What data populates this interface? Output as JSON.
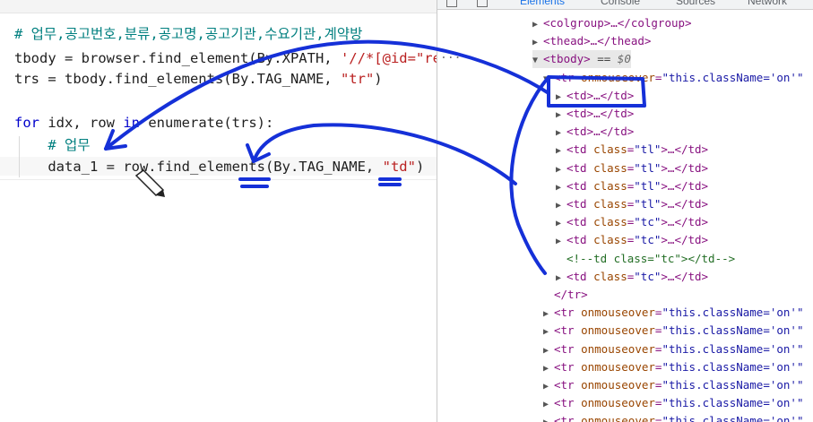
{
  "editor": {
    "lines": [
      {
        "tokens": [
          {
            "t": "# 업무,공고번호,분류,공고명,공고기관,수요기관,계약방",
            "c": "cm"
          }
        ]
      },
      {
        "tokens": [
          {
            "t": "tbody = browser.find_element(By.XPATH, ",
            "c": ""
          },
          {
            "t": "'//*[@id=\"resu",
            "c": "str"
          }
        ]
      },
      {
        "tokens": [
          {
            "t": "trs = tbody.find_elements(By.TAG_NAME, ",
            "c": ""
          },
          {
            "t": "\"tr\"",
            "c": "str"
          },
          {
            "t": ")",
            "c": ""
          }
        ]
      },
      {
        "tokens": []
      },
      {
        "tokens": [
          {
            "t": "for",
            "c": "kw"
          },
          {
            "t": " idx, row ",
            "c": ""
          },
          {
            "t": "in",
            "c": "kw"
          },
          {
            "t": " enumerate(trs):",
            "c": ""
          }
        ]
      },
      {
        "tokens": [
          {
            "t": "    # 업무",
            "c": "cm"
          }
        ]
      },
      {
        "tokens": [
          {
            "t": "    data_1 = row.find_elements(By.TAG_NAME, ",
            "c": ""
          },
          {
            "t": "\"td\"",
            "c": "str"
          },
          {
            "t": ")",
            "c": ""
          }
        ]
      }
    ]
  },
  "devtools": {
    "tabs": [
      "Elements",
      "Console",
      "Sources",
      "Network"
    ],
    "ellipsis": "...",
    "rows": [
      {
        "parts": [
          {
            "t": "▶",
            "c": "tri"
          },
          {
            "t": "<colgroup>…</colgroup>",
            "c": "tag"
          }
        ]
      },
      {
        "parts": [
          {
            "t": "▶",
            "c": "tri"
          },
          {
            "t": "<thead>…</thead>",
            "c": "tag"
          }
        ]
      },
      {
        "parts": [
          {
            "t": "▼",
            "c": "tri"
          },
          {
            "t": "<tbody>",
            "c": "tag"
          },
          {
            "t": " == ",
            "c": "eq"
          },
          {
            "t": "$0",
            "c": "sel"
          }
        ]
      },
      {
        "parts": [
          {
            "t": "▼",
            "c": "tri"
          },
          {
            "t": "<tr ",
            "c": "tag"
          },
          {
            "t": "onmouseover",
            "c": "an"
          },
          {
            "t": "=",
            "c": "tag"
          },
          {
            "t": "\"this.className='on'\"",
            "c": "av"
          }
        ]
      },
      {
        "parts": [
          {
            "t": "▶",
            "c": "tri"
          },
          {
            "t": "<td>…</td>",
            "c": "tag"
          }
        ]
      },
      {
        "parts": [
          {
            "t": "▶",
            "c": "tri"
          },
          {
            "t": "<td>…</td>",
            "c": "tag"
          }
        ]
      },
      {
        "parts": [
          {
            "t": "▶",
            "c": "tri"
          },
          {
            "t": "<td>…</td>",
            "c": "tag"
          }
        ]
      },
      {
        "parts": [
          {
            "t": "▶",
            "c": "tri"
          },
          {
            "t": "<td ",
            "c": "tag"
          },
          {
            "t": "class",
            "c": "an"
          },
          {
            "t": "=",
            "c": "tag"
          },
          {
            "t": "\"tl\"",
            "c": "av"
          },
          {
            "t": ">…</td>",
            "c": "tag"
          }
        ]
      },
      {
        "parts": [
          {
            "t": "▶",
            "c": "tri"
          },
          {
            "t": "<td ",
            "c": "tag"
          },
          {
            "t": "class",
            "c": "an"
          },
          {
            "t": "=",
            "c": "tag"
          },
          {
            "t": "\"tl\"",
            "c": "av"
          },
          {
            "t": ">…</td>",
            "c": "tag"
          }
        ]
      },
      {
        "parts": [
          {
            "t": "▶",
            "c": "tri"
          },
          {
            "t": "<td ",
            "c": "tag"
          },
          {
            "t": "class",
            "c": "an"
          },
          {
            "t": "=",
            "c": "tag"
          },
          {
            "t": "\"tl\"",
            "c": "av"
          },
          {
            "t": ">…</td>",
            "c": "tag"
          }
        ]
      },
      {
        "parts": [
          {
            "t": "▶",
            "c": "tri"
          },
          {
            "t": "<td ",
            "c": "tag"
          },
          {
            "t": "class",
            "c": "an"
          },
          {
            "t": "=",
            "c": "tag"
          },
          {
            "t": "\"tl\"",
            "c": "av"
          },
          {
            "t": ">…</td>",
            "c": "tag"
          }
        ]
      },
      {
        "parts": [
          {
            "t": "▶",
            "c": "tri"
          },
          {
            "t": "<td ",
            "c": "tag"
          },
          {
            "t": "class",
            "c": "an"
          },
          {
            "t": "=",
            "c": "tag"
          },
          {
            "t": "\"tc\"",
            "c": "av"
          },
          {
            "t": ">…</td>",
            "c": "tag"
          }
        ]
      },
      {
        "parts": [
          {
            "t": "▶",
            "c": "tri"
          },
          {
            "t": "<td ",
            "c": "tag"
          },
          {
            "t": "class",
            "c": "an"
          },
          {
            "t": "=",
            "c": "tag"
          },
          {
            "t": "\"tc\"",
            "c": "av"
          },
          {
            "t": ">…</td>",
            "c": "tag"
          }
        ]
      },
      {
        "parts": [
          {
            "t": " ",
            "c": "tri"
          },
          {
            "t": "<!--td class=\"tc\"></td-->",
            "c": "com"
          }
        ]
      },
      {
        "parts": [
          {
            "t": "▶",
            "c": "tri"
          },
          {
            "t": "<td ",
            "c": "tag"
          },
          {
            "t": "class",
            "c": "an"
          },
          {
            "t": "=",
            "c": "tag"
          },
          {
            "t": "\"tc\"",
            "c": "av"
          },
          {
            "t": ">…</td>",
            "c": "tag"
          }
        ]
      },
      {
        "parts": [
          {
            "t": " ",
            "c": "tri"
          },
          {
            "t": "</tr>",
            "c": "tag"
          }
        ]
      },
      {
        "parts": [
          {
            "t": "▶",
            "c": "tri"
          },
          {
            "t": "<tr ",
            "c": "tag"
          },
          {
            "t": "onmouseover",
            "c": "an"
          },
          {
            "t": "=",
            "c": "tag"
          },
          {
            "t": "\"this.className='on'\"",
            "c": "av"
          }
        ]
      },
      {
        "parts": [
          {
            "t": "▶",
            "c": "tri"
          },
          {
            "t": "<tr ",
            "c": "tag"
          },
          {
            "t": "onmouseover",
            "c": "an"
          },
          {
            "t": "=",
            "c": "tag"
          },
          {
            "t": "\"this.className='on'\"",
            "c": "av"
          }
        ]
      },
      {
        "parts": [
          {
            "t": "▶",
            "c": "tri"
          },
          {
            "t": "<tr ",
            "c": "tag"
          },
          {
            "t": "onmouseover",
            "c": "an"
          },
          {
            "t": "=",
            "c": "tag"
          },
          {
            "t": "\"this.className='on'\"",
            "c": "av"
          }
        ]
      },
      {
        "parts": [
          {
            "t": "▶",
            "c": "tri"
          },
          {
            "t": "<tr ",
            "c": "tag"
          },
          {
            "t": "onmouseover",
            "c": "an"
          },
          {
            "t": "=",
            "c": "tag"
          },
          {
            "t": "\"this.className='on'\"",
            "c": "av"
          }
        ]
      },
      {
        "parts": [
          {
            "t": "▶",
            "c": "tri"
          },
          {
            "t": "<tr ",
            "c": "tag"
          },
          {
            "t": "onmouseover",
            "c": "an"
          },
          {
            "t": "=",
            "c": "tag"
          },
          {
            "t": "\"this.className='on'\"",
            "c": "av"
          }
        ]
      },
      {
        "parts": [
          {
            "t": "▶",
            "c": "tri"
          },
          {
            "t": "<tr ",
            "c": "tag"
          },
          {
            "t": "onmouseover",
            "c": "an"
          },
          {
            "t": "=",
            "c": "tag"
          },
          {
            "t": "\"this.className='on'\"",
            "c": "av"
          }
        ]
      },
      {
        "parts": [
          {
            "t": "▶",
            "c": "tri"
          },
          {
            "t": "<tr ",
            "c": "tag"
          },
          {
            "t": "onmouseover",
            "c": "an"
          },
          {
            "t": "=",
            "c": "tag"
          },
          {
            "t": "\"this.className='on'\"",
            "c": "av"
          }
        ]
      }
    ]
  },
  "colors": {
    "annotation_ink": "#1530d8",
    "code_string": "#ba2121",
    "code_keyword": "#0000cc",
    "code_comment": "#007f7f"
  }
}
